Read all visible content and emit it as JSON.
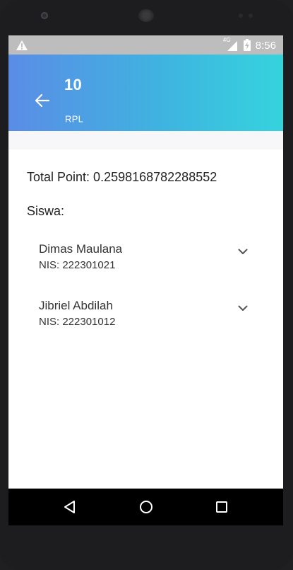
{
  "status_bar": {
    "network": "4G",
    "time": "8:56",
    "icons": [
      "warning-icon",
      "signal-icon",
      "battery-icon"
    ]
  },
  "app_bar": {
    "title": "10",
    "subtitle": "RPL",
    "back_icon": "arrow-left-icon",
    "gradient": [
      "#5b8ce6",
      "#35d3de"
    ]
  },
  "content": {
    "total_point": "Total Point: 0.2598168782288552",
    "students_label": "Siswa:",
    "students": [
      {
        "name": "Dimas Maulana",
        "nis": "NIS: 222301021"
      },
      {
        "name": "Jibriel Abdilah",
        "nis": "NIS: 222301012"
      }
    ]
  },
  "nav_bar": {
    "buttons": [
      "back-triangle-icon",
      "home-circle-icon",
      "recents-square-icon"
    ]
  }
}
